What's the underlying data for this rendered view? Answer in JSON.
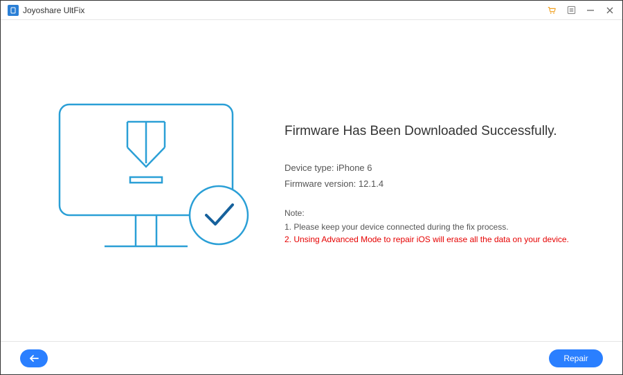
{
  "titlebar": {
    "app_name": "Joyoshare UltFix"
  },
  "content": {
    "heading": "Firmware Has Been Downloaded Successfully.",
    "device_type_label": "Device type:",
    "device_type_value": "iPhone 6",
    "firmware_version_label": "Firmware version:",
    "firmware_version_value": "12.1.4",
    "note_label": "Note:",
    "note_1": "1. Please keep your device connected during the fix process.",
    "note_2": "2. Unsing Advanced Mode to repair iOS will erase all the data on your device."
  },
  "footer": {
    "repair_label": "Repair"
  }
}
